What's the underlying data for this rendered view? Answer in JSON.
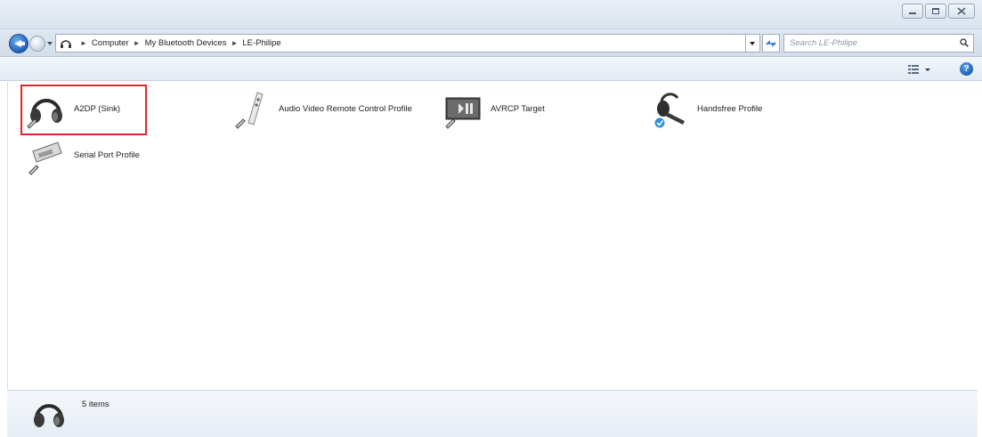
{
  "window": {
    "caption_buttons": [
      "minimize",
      "maximize",
      "close"
    ]
  },
  "address_bar": {
    "crumbs": [
      "Computer",
      "My Bluetooth Devices",
      "LE-Philipe"
    ]
  },
  "search": {
    "placeholder": "Search LE-Philipe"
  },
  "toolbar": {
    "help_label": "?"
  },
  "items": [
    {
      "label": "A2DP (Sink)",
      "icon": "headphones-icon",
      "selected": true
    },
    {
      "label": "Audio Video Remote Control Profile",
      "icon": "remote-control-icon",
      "selected": false
    },
    {
      "label": "AVRCP Target",
      "icon": "media-player-icon",
      "selected": false
    },
    {
      "label": "Handsfree Profile",
      "icon": "headset-icon",
      "selected": false
    },
    {
      "label": "Serial Port Profile",
      "icon": "serial-port-icon",
      "selected": false
    }
  ],
  "details": {
    "count_text": "5 items",
    "icon": "headphones-icon"
  },
  "colors": {
    "selection_border": "#e0262c",
    "accent_blue": "#1f5fb6"
  }
}
